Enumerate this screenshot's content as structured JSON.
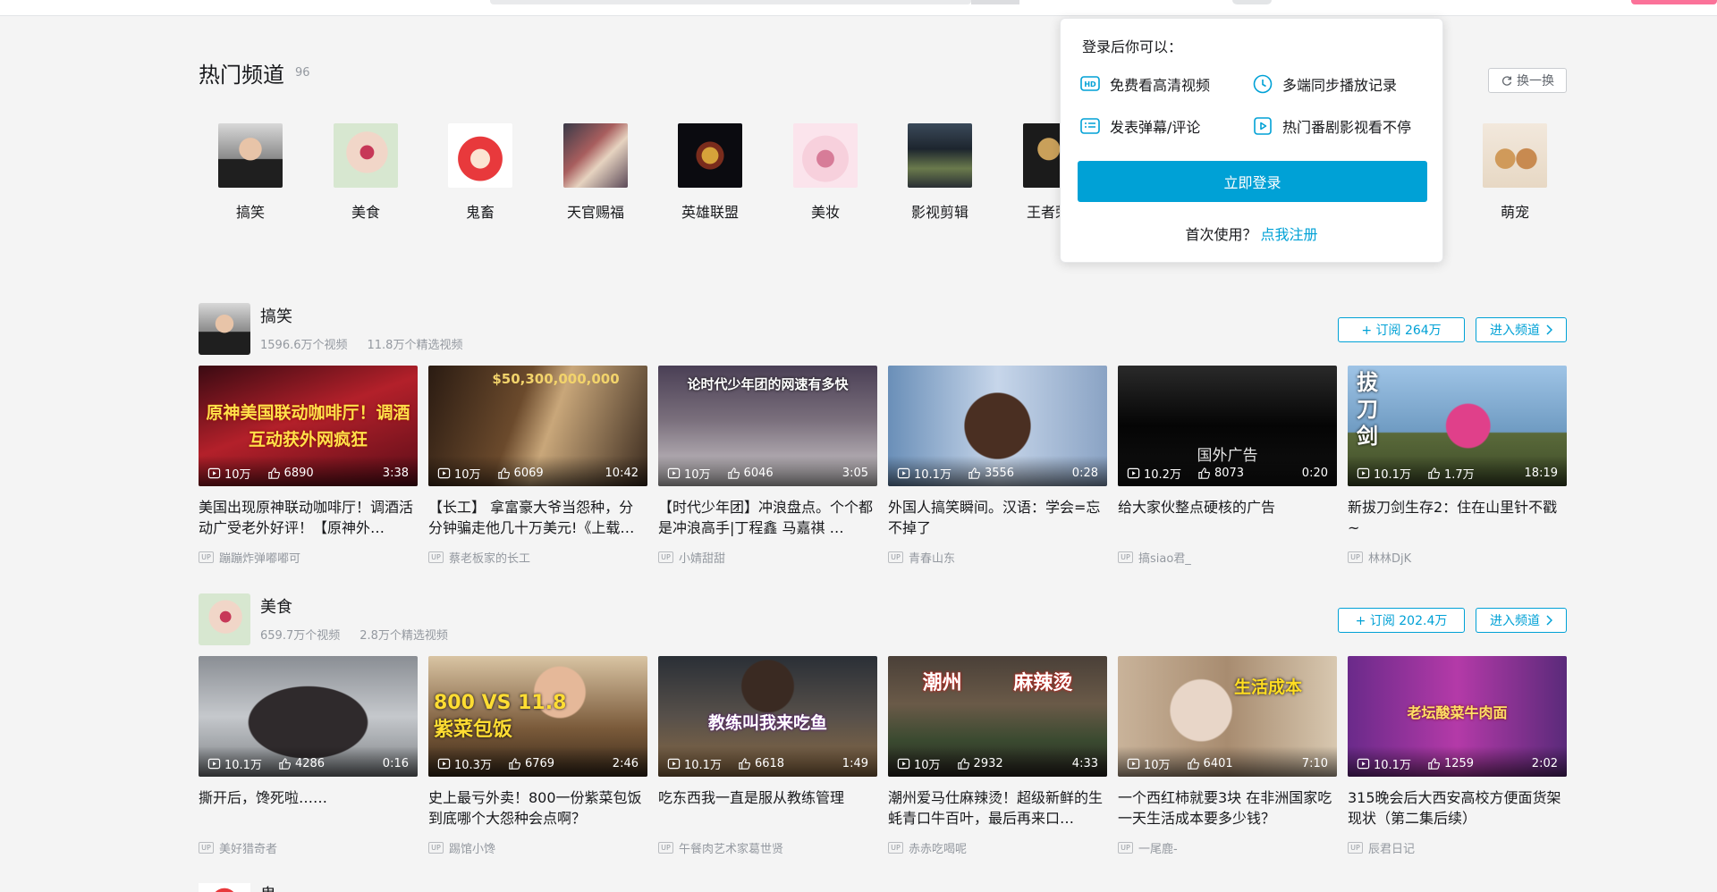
{
  "hot": {
    "title": "热门频道",
    "count": "96",
    "refresh_label": "换一换",
    "channels": [
      {
        "name": "搞笑"
      },
      {
        "name": "美食"
      },
      {
        "name": "鬼畜"
      },
      {
        "name": "天官赐福"
      },
      {
        "name": "英雄联盟"
      },
      {
        "name": "美妆"
      },
      {
        "name": "影视剪辑"
      },
      {
        "name": "王者荣耀"
      },
      {
        "name": "萌宠"
      }
    ]
  },
  "login_popover": {
    "title": "登录后你可以：",
    "benefits": [
      "免费看高清视频",
      "多端同步播放记录",
      "发表弹幕/评论",
      "热门番剧影视看不停"
    ],
    "login_label": "立即登录",
    "register_prompt": "首次使用？",
    "register_link": "点我注册"
  },
  "sections": [
    {
      "name": "搞笑",
      "video_count": "1596.6万个视频",
      "featured_count": "11.8万个精选视频",
      "subscribe_label": "+ 订阅 264万",
      "enter_label": "进入频道",
      "videos": [
        {
          "views": "10万",
          "likes": "6890",
          "duration": "3:38",
          "overlay": "原神美国联动咖啡厅！调酒互动获外网疯狂",
          "title": "美国出现原神联动咖啡厅！调酒活动广受老外好评！【原神外…",
          "up": "蹦蹦炸弹嘟嘟可"
        },
        {
          "views": "10万",
          "likes": "6069",
          "duration": "10:42",
          "overlay": "$50,300,000,000",
          "title": "【长工】 拿富豪大爷当怨种，分分钟骗走他几十万美元!《上载…",
          "up": "蔡老板家的长工"
        },
        {
          "views": "10万",
          "likes": "6046",
          "duration": "3:05",
          "overlay": "论时代少年团的网速有多快",
          "title": "【时代少年团】冲浪盘点。个个都是冲浪高手|丁程鑫 马嘉祺 …",
          "up": "小婧甜甜"
        },
        {
          "views": "10.1万",
          "likes": "3556",
          "duration": "0:28",
          "overlay": "",
          "title": "外国人搞笑瞬间。汉语：学会=忘不掉了",
          "up": "青春山东"
        },
        {
          "views": "10.2万",
          "likes": "8073",
          "duration": "0:20",
          "overlay": "国外广告",
          "title": "给大家伙整点硬核的广告",
          "up": "搞siao君_"
        },
        {
          "views": "10.1万",
          "likes": "1.7万",
          "duration": "18:19",
          "overlay": "拔刀剑",
          "title": "新拔刀剑生存2：住在山里针不戳~",
          "up": "林林DjK"
        }
      ]
    },
    {
      "name": "美食",
      "video_count": "659.7万个视频",
      "featured_count": "2.8万个精选视频",
      "subscribe_label": "+ 订阅 202.4万",
      "enter_label": "进入频道",
      "videos": [
        {
          "views": "10.1万",
          "likes": "4286",
          "duration": "0:16",
          "overlay": "",
          "title": "撕开后，馋死啦……",
          "up": "美好猎奇者"
        },
        {
          "views": "10.3万",
          "likes": "6769",
          "duration": "2:46",
          "overlay": "800 VS 11.8 紫菜包饭",
          "title": "史上最亏外卖！800一份紫菜包饭到底哪个大怨种会点啊？",
          "up": "踢馆小馋"
        },
        {
          "views": "10.1万",
          "likes": "6618",
          "duration": "1:49",
          "overlay": "教练叫我来吃鱼",
          "title": "吃东西我一直是服从教练管理",
          "up": "午餐肉艺术家葛世贤"
        },
        {
          "views": "10万",
          "likes": "2932",
          "duration": "4:33",
          "overlay": "潮州 麻辣烫",
          "title": "潮州爱马仕麻辣烫！超级新鲜的生蚝青口牛百叶，最后再来口…",
          "up": "赤赤吃喝呢"
        },
        {
          "views": "10万",
          "likes": "6401",
          "duration": "7:10",
          "overlay": "生活成本",
          "title": "一个西红柿就要3块 在非洲国家吃一天生活成本要多少钱？",
          "up": "一尾鹿-"
        },
        {
          "views": "10.1万",
          "likes": "1259",
          "duration": "2:02",
          "overlay": "老坛酸菜牛肉面",
          "title": "315晚会后大西安高校方便面货架现状（第二集后续）",
          "up": "辰君日记"
        }
      ]
    }
  ],
  "next_section": {
    "name": "鬼畜"
  },
  "colors": {
    "accent": "#00a1d6",
    "text": "#18191c",
    "muted": "#9499a0",
    "brand_pink": "#fb7299"
  }
}
